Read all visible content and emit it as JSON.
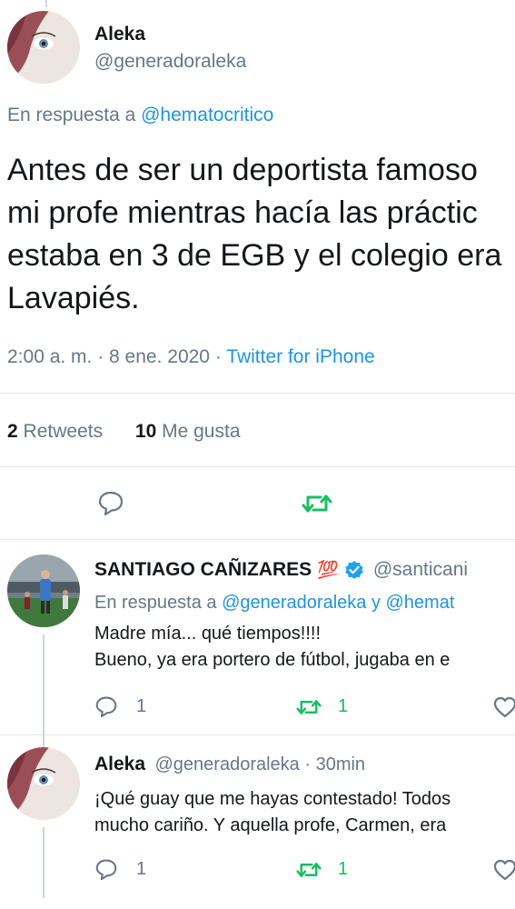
{
  "tweet": {
    "author_name": "Aleka",
    "author_handle": "@generadoraleka",
    "reply_prefix": "En respuesta a",
    "reply_to": "@hematocritico",
    "text_lines": [
      "Antes de ser un deportista famoso",
      "mi profe mientras hacía las práctic",
      "estaba en 3 de EGB y el colegio era",
      "Lavapiés."
    ],
    "timestamp": "2:00 a. m. · 8 ene. 2020 ·",
    "source": "Twitter for iPhone",
    "retweets_count": "2",
    "retweets_label": "Retweets",
    "likes_count": "10",
    "likes_label": "Me gusta"
  },
  "replies": [
    {
      "author_name": "SANTIAGO CAÑIZARES",
      "emoji": "💯",
      "author_handle": "@santicani",
      "reply_prefix": "En respuesta a",
      "reply_to": "@generadoraleka y @hemat",
      "text_lines": [
        "Madre mía... qué tiempos!!!!",
        "Bueno, ya era portero de fútbol, jugaba en e"
      ],
      "reply_count": "1",
      "retweet_count": "1"
    },
    {
      "author_name": "Aleka",
      "author_handle": "@generadoraleka · 30min",
      "text_lines": [
        "¡Qué guay que me hayas contestado! Todos",
        "mucho cariño. Y aquella profe, Carmen, era"
      ],
      "reply_count": "1",
      "retweet_count": "1"
    }
  ],
  "colors": {
    "link": "#1b95e0",
    "retweet_active": "#17bf63",
    "muted": "#657786",
    "verified": "#1da1f2"
  },
  "icons": [
    "reply-icon",
    "retweet-icon",
    "like-icon",
    "verified-icon",
    "hundred-points-emoji"
  ]
}
